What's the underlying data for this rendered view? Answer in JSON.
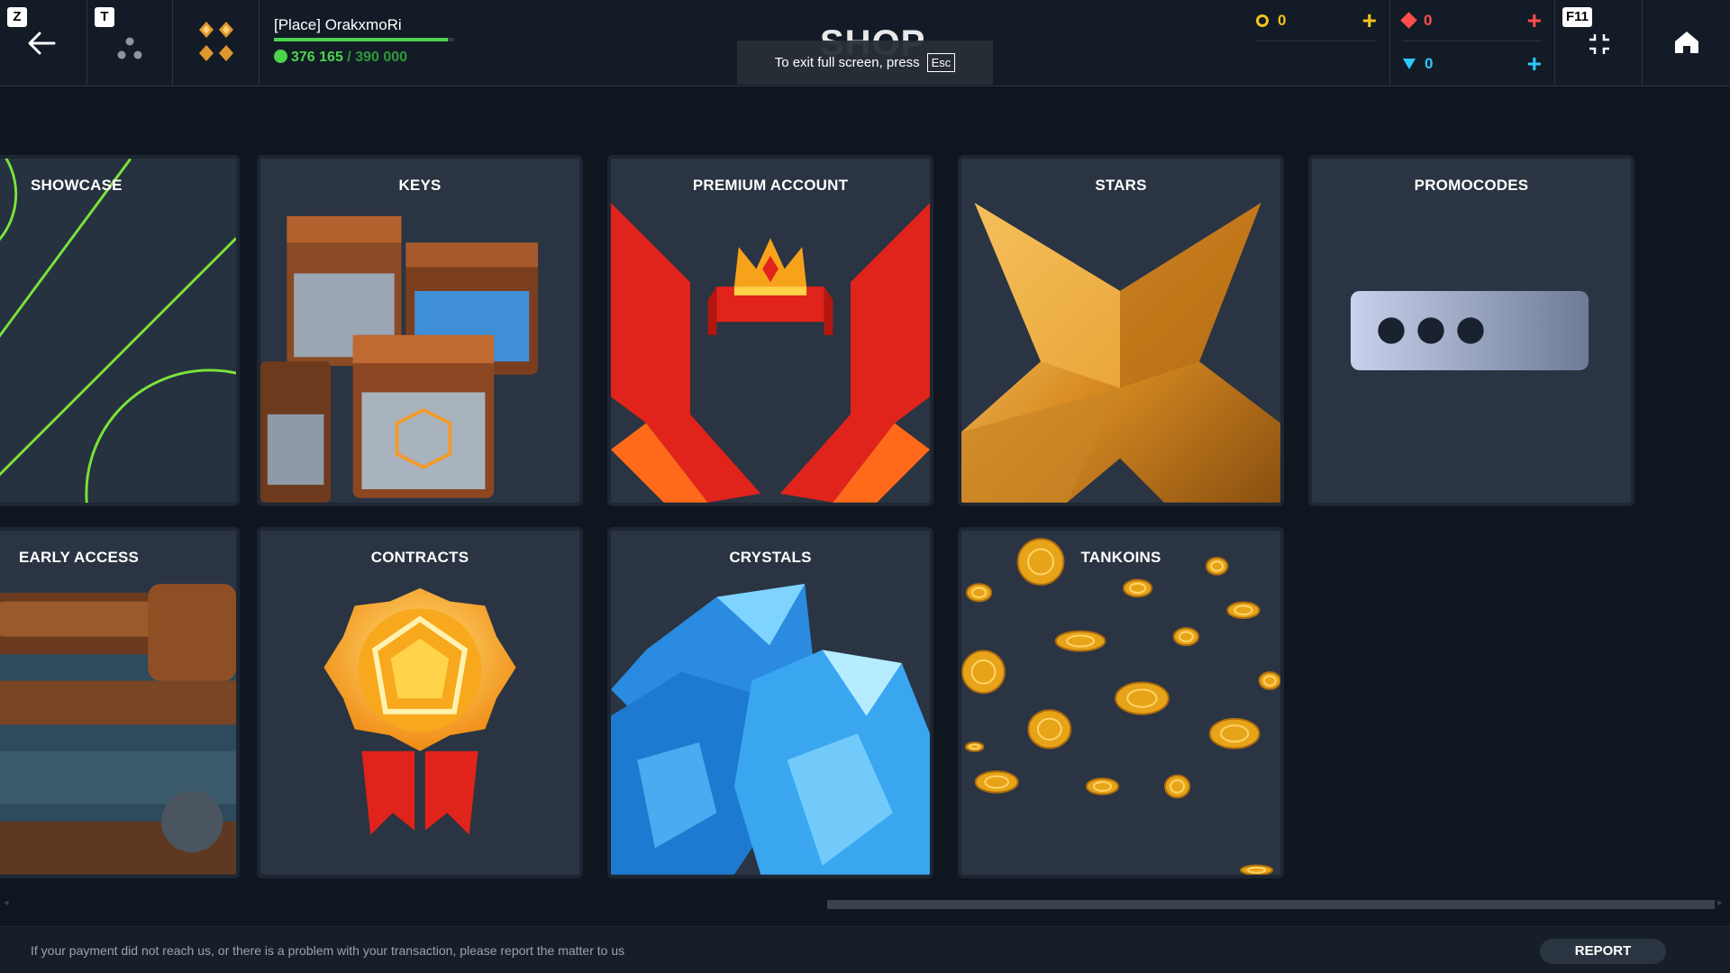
{
  "header": {
    "back_key": "Z",
    "friends_key": "T",
    "fullscreen_key": "F11",
    "page_title": "SHOP",
    "fullscreen_notice": {
      "text": "To exit full screen, press",
      "key": "Esc"
    }
  },
  "profile": {
    "name": "[Place] OrakxmoRi",
    "xp_current": "376 165",
    "xp_max": "/ 390 000",
    "xp_progress": 0.965
  },
  "currencies": {
    "coins": {
      "value": "0",
      "color": "#f2c21b"
    },
    "rubies": {
      "value": "0",
      "color": "#ff4d4d"
    },
    "crystals": {
      "value": "0",
      "color": "#2ec7ff"
    }
  },
  "cards": {
    "showcase": "SHOWCASE",
    "keys": "KEYS",
    "premium": "PREMIUM ACCOUNT",
    "stars": "STARS",
    "promocodes": "PROMOCODES",
    "early_access": "EARLY ACCESS",
    "contracts": "CONTRACTS",
    "crystals": "CRYSTALS",
    "tankoins": "TANKOINS"
  },
  "footer": {
    "notice": "If your payment did not reach us, or there is a problem with your transaction, please report the matter to us",
    "report_label": "REPORT"
  },
  "icons": [
    "back-arrow-icon",
    "friends-icon",
    "rank-icon",
    "coin-icon",
    "ruby-icon",
    "crystal-icon",
    "plus-icon",
    "exit-fullscreen-icon",
    "home-icon"
  ]
}
